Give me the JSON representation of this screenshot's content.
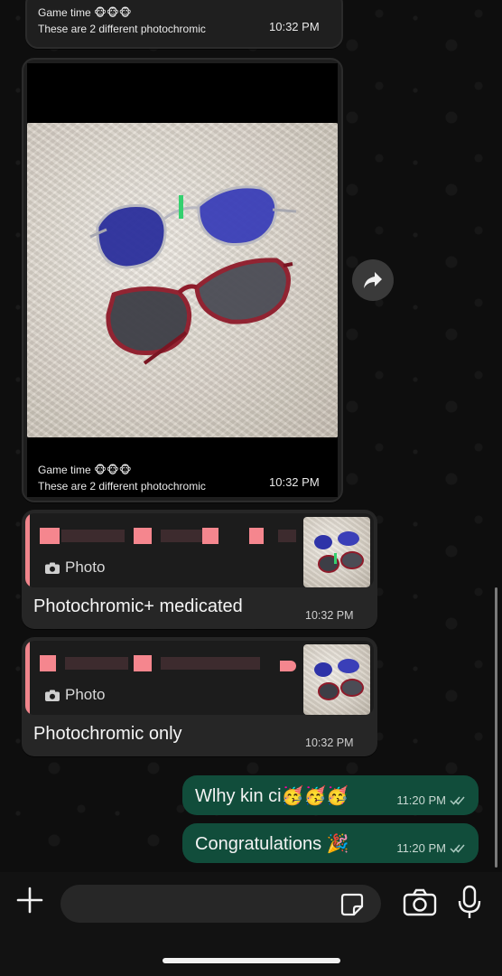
{
  "chat": {
    "forwarded_top": {
      "title": "Game time 🐵🐵🐵",
      "line2": "These are 2 different photochromic",
      "time": "10:32 PM"
    },
    "photo_message": {
      "title": "Game time 🐵🐵🐵",
      "line2": "These are 2 different photochromic",
      "time": "10:32 PM"
    },
    "reply_1": {
      "quoted_type": "Photo",
      "text": "Photochromic+ medicated",
      "time": "10:32 PM"
    },
    "reply_2": {
      "quoted_type": "Photo",
      "text": "Photochromic only",
      "time": "10:32 PM"
    },
    "outgoing": [
      {
        "text": "Wlhy kin ci🥳🥳🥳",
        "time": "11:20 PM"
      },
      {
        "text": "Congratulations 🎉",
        "time": "11:20 PM"
      }
    ]
  },
  "composer": {
    "placeholder": ""
  },
  "colors": {
    "outgoing_bubble": "#114d3b",
    "incoming_bubble": "#262626",
    "quote_accent": "#f0858c"
  },
  "icons": [
    "forward-icon",
    "camera-small-icon",
    "read-receipt-icon",
    "plus-icon",
    "sticker-icon",
    "camera-icon",
    "mic-icon"
  ]
}
